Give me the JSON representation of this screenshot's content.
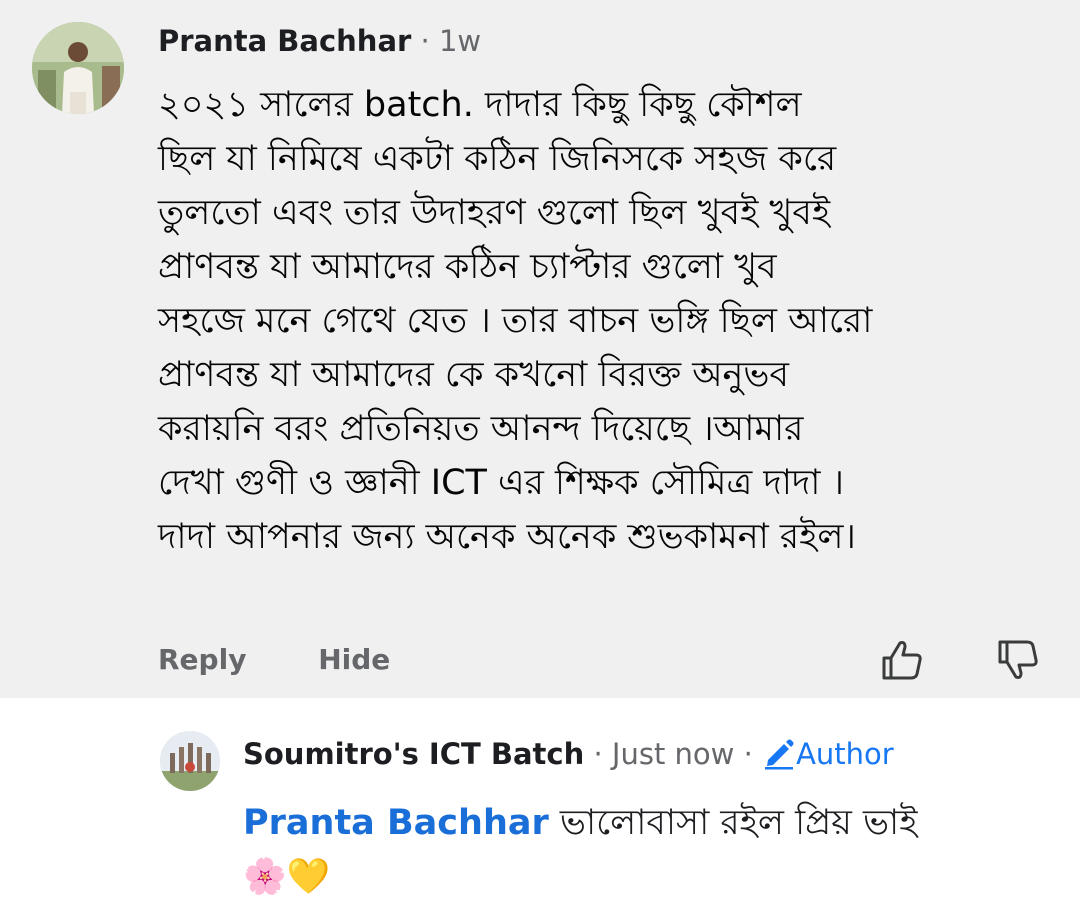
{
  "comment": {
    "author": "Pranta Bachhar",
    "separator": "·",
    "time": "1w",
    "lines": [
      "২০২১ সালের batch.  দাদার  কিছু কিছু কৌশল",
      "ছিল যা নিমিষে একটা কঠিন জিনিসকে সহজ করে",
      "তুলতো  এবং  তার উদাহরণ গুলো ছিল  খুবই খুবই",
      "প্রাণবন্ত  যা আমাদের কঠিন  চ্যাপ্টার গুলো  খুব",
      "সহজে মনে গেথে যেত । তার বাচন ভঙ্গি ছিল আরো",
      "প্রাণবন্ত  যা আমাদের কে কখনো বিরক্ত অনুভব",
      "করায়নি বরং  প্রতিনিয়ত আনন্দ দিয়েছে ।আমার",
      "দেখা গুণী ও জ্ঞানী  ICT এর শিক্ষক  সৌমিত্র দাদা ।",
      "দাদা আপনার জন্য অনেক অনেক শুভকামনা রইল।"
    ],
    "actions": {
      "reply": "Reply",
      "hide": "Hide"
    },
    "icons": [
      "like-icon",
      "dislike-icon"
    ]
  },
  "reply": {
    "author": "Soumitro's ICT Batch",
    "separator": "·",
    "time": "Just now",
    "separator2": "·",
    "badge": "Author",
    "mention": "Pranta Bachhar",
    "text": " ভালোবাসা রইল প্রিয় ভাই",
    "emoji": "🌸💛"
  },
  "colors": {
    "top_background": "#f0f0f0",
    "bottom_background": "#ffffff",
    "accent": "#1877f2",
    "mention": "#1a6ed8",
    "meta": "#65676b"
  }
}
